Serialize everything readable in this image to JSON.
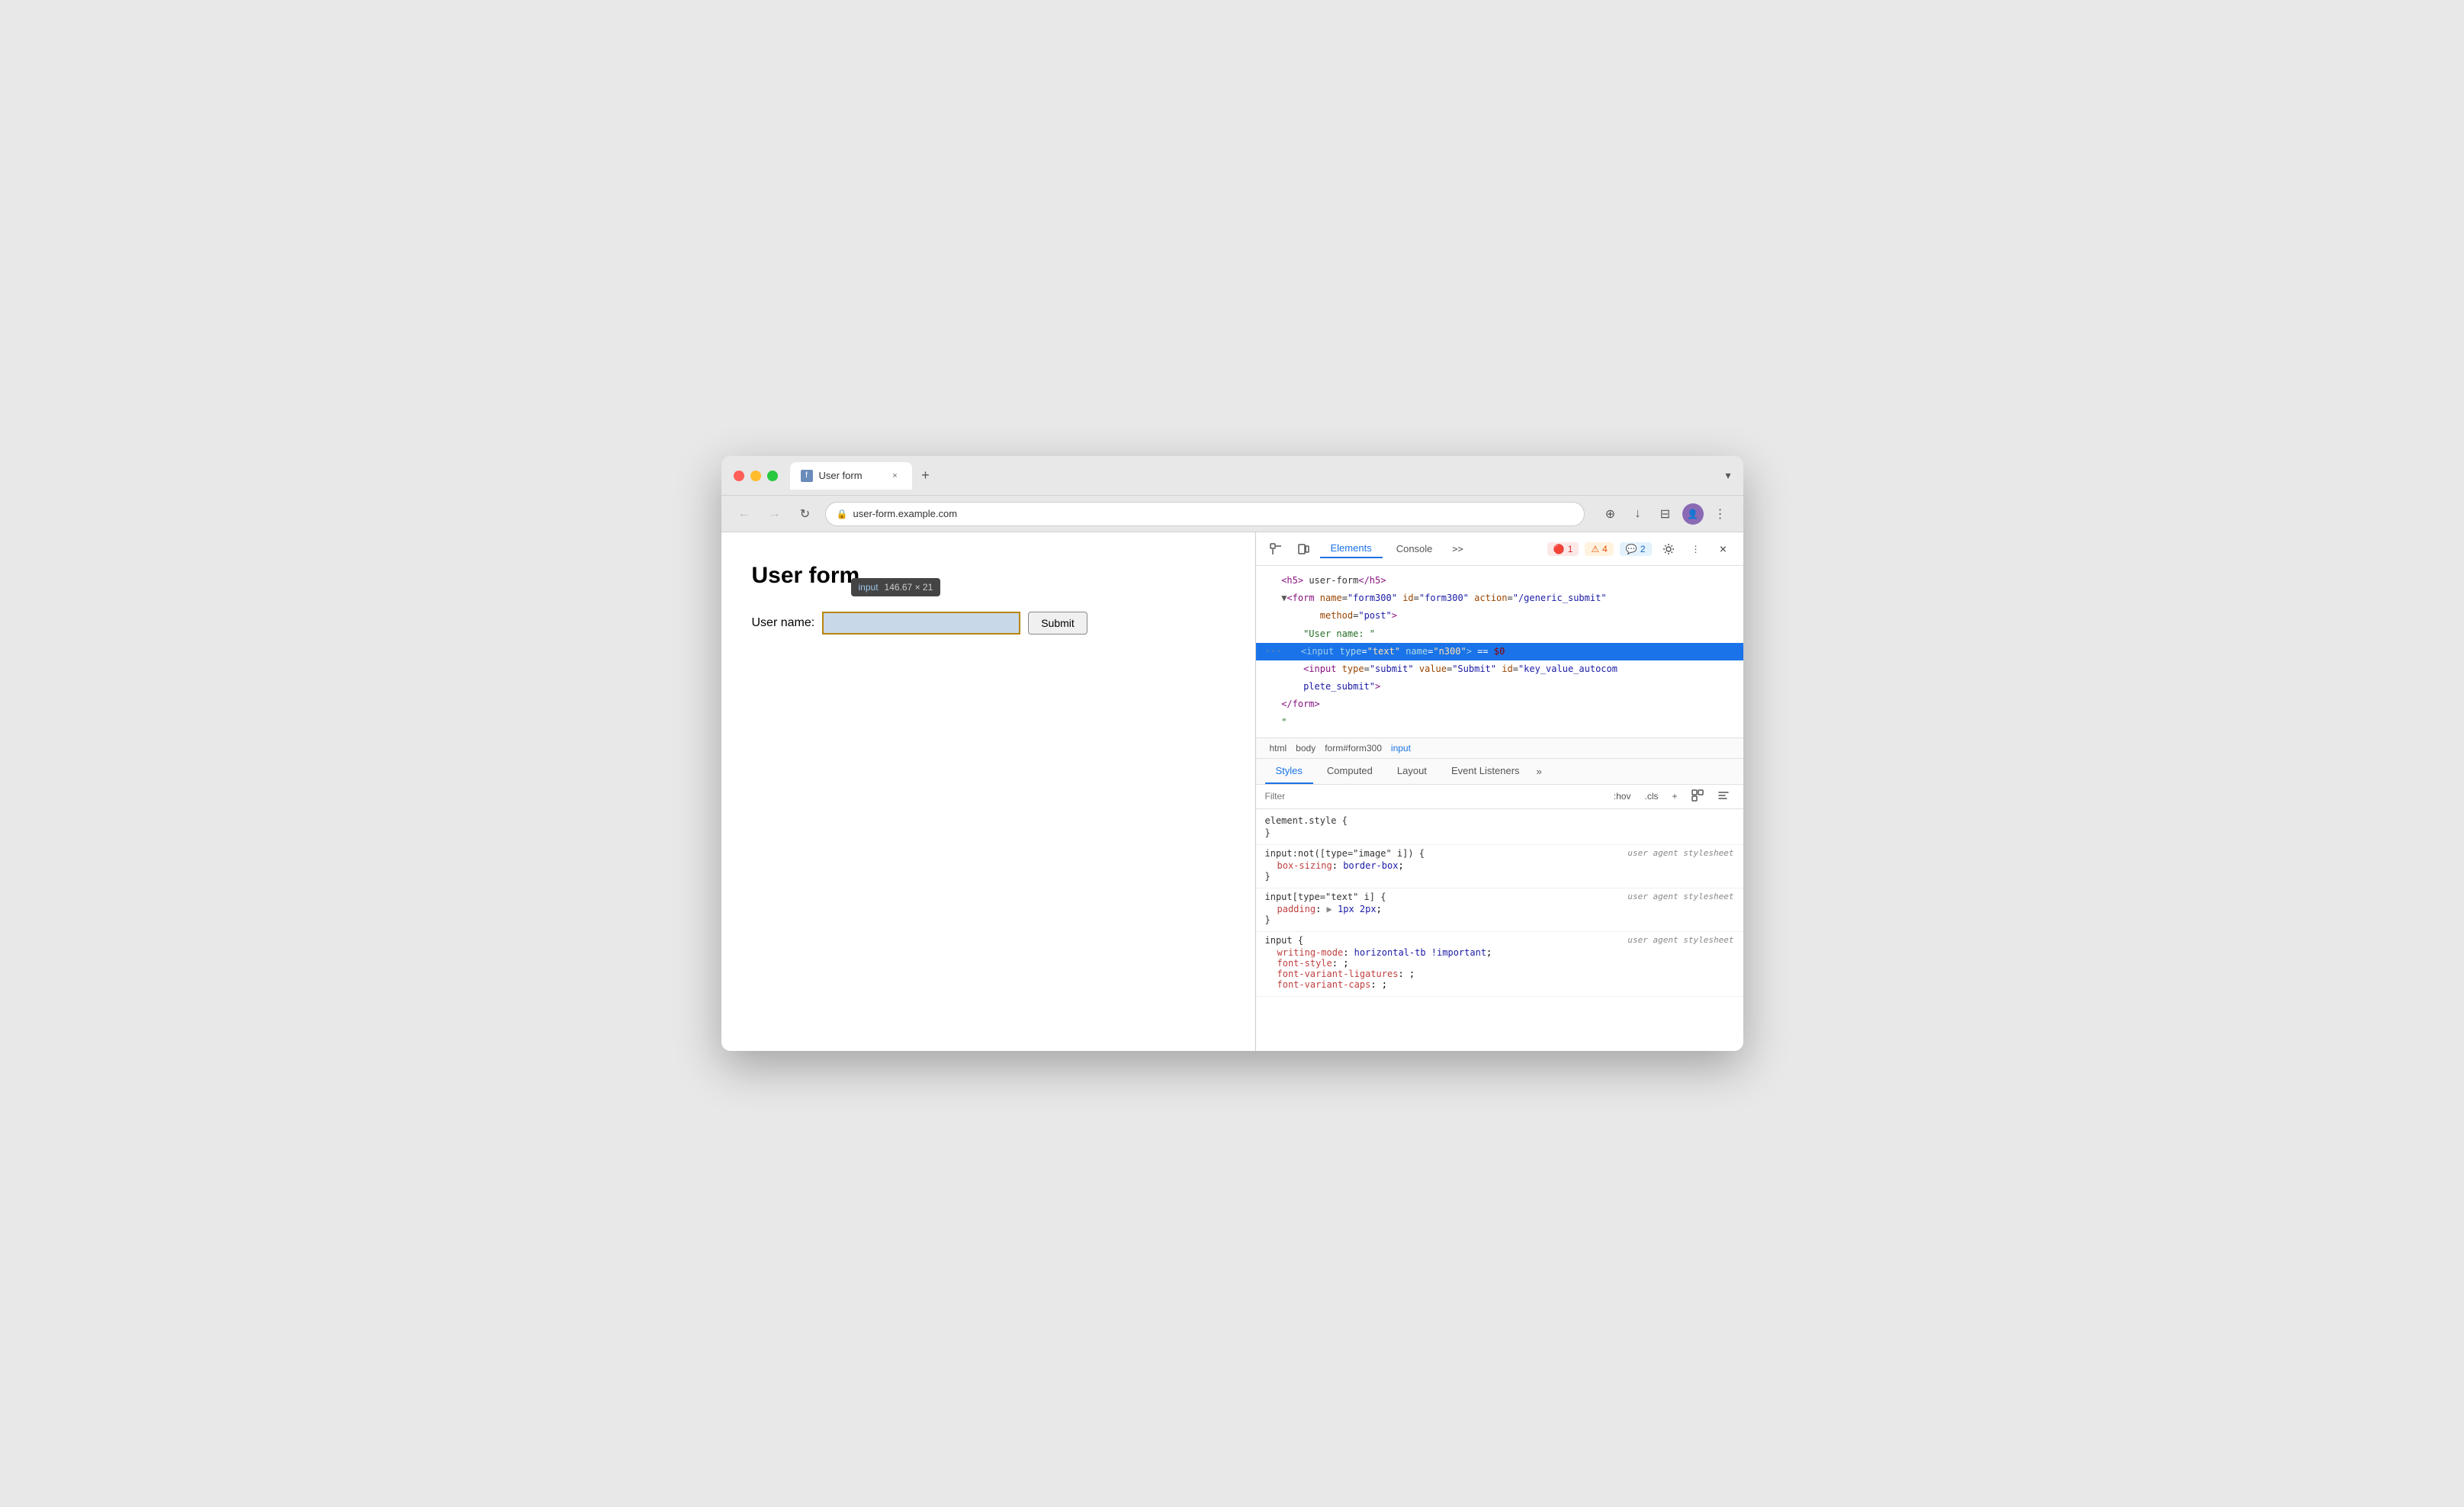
{
  "browser": {
    "tab_title": "User form",
    "tab_close": "×",
    "new_tab": "+",
    "tab_overflow": "▾",
    "url": "user-form.example.com",
    "nav_back": "←",
    "nav_forward": "→",
    "nav_reload": "↻",
    "toolbar": {
      "extensions": "⊕",
      "download": "↓",
      "split": "⊟",
      "more": "⋮"
    }
  },
  "page": {
    "title": "User form",
    "form_label": "User name:",
    "submit_label": "Submit",
    "input_tooltip_label": "input",
    "input_tooltip_size": "146.67 × 21"
  },
  "devtools": {
    "toolbar": {
      "inspect_icon": "⊡",
      "device_icon": "⊞",
      "elements_tab": "Elements",
      "console_tab": "Console",
      "more_tabs": ">>",
      "badge_error_icon": "🔴",
      "badge_error_count": "1",
      "badge_warning_icon": "⚠",
      "badge_warning_count": "4",
      "badge_info_icon": "💬",
      "badge_info_count": "2",
      "settings_icon": "⚙",
      "more_options": "⋮",
      "close_icon": "×"
    },
    "dom": {
      "line1": "<h5> user-form</h5>",
      "line2_prefix": "▼",
      "line2": "<form name=\"form300\" id=\"form300\" action=\"/generic_submit\"",
      "line2b": "      method=\"post\">",
      "line3": "    \"User name: \"",
      "line4_selected": "    <input type=\"text\" name=\"n300\"> == $0",
      "line5": "    <input type=\"submit\" value=\"Submit\" id=\"key_value_autocom",
      "line5b": "    plete_submit\">",
      "line6": "</form>",
      "line7": "\""
    },
    "breadcrumbs": [
      "html",
      "body",
      "form#form300",
      "input"
    ],
    "styles_tabs": [
      "Styles",
      "Computed",
      "Layout",
      "Event Listeners"
    ],
    "active_styles_tab": "Styles",
    "more_tabs_label": "»",
    "filter_placeholder": "Filter",
    "filter_hov": ":hov",
    "filter_cls": ".cls",
    "filter_plus": "+",
    "filter_icon1": "⊞",
    "filter_icon2": "⊟",
    "css_rules": [
      {
        "selector": "element.style {",
        "close": "}",
        "source": "",
        "props": []
      },
      {
        "selector": "input:not([type=\"image\" i]) {",
        "close": "}",
        "source": "user agent stylesheet",
        "props": [
          {
            "name": "box-sizing",
            "value": "border-box",
            "sep": ": ",
            "end": ";"
          }
        ]
      },
      {
        "selector": "input[type=\"text\" i] {",
        "close": "}",
        "source": "user agent stylesheet",
        "props": [
          {
            "name": "padding",
            "arrow": "▶",
            "value": "1px 2px",
            "sep": ": ",
            "end": ";"
          }
        ]
      },
      {
        "selector": "input {",
        "close": "}",
        "source": "user agent stylesheet",
        "props": [
          {
            "name": "writing-mode",
            "value": "horizontal-tb !important",
            "sep": ": ",
            "end": ";"
          },
          {
            "name": "font-style",
            "value": ";",
            "sep": ": ",
            "end": ""
          },
          {
            "name": "font-variant-ligatures",
            "value": ";",
            "sep": ": ",
            "end": ""
          },
          {
            "name": "font-variant-caps",
            "value": ";",
            "sep": ": ",
            "end": ""
          }
        ]
      }
    ]
  }
}
